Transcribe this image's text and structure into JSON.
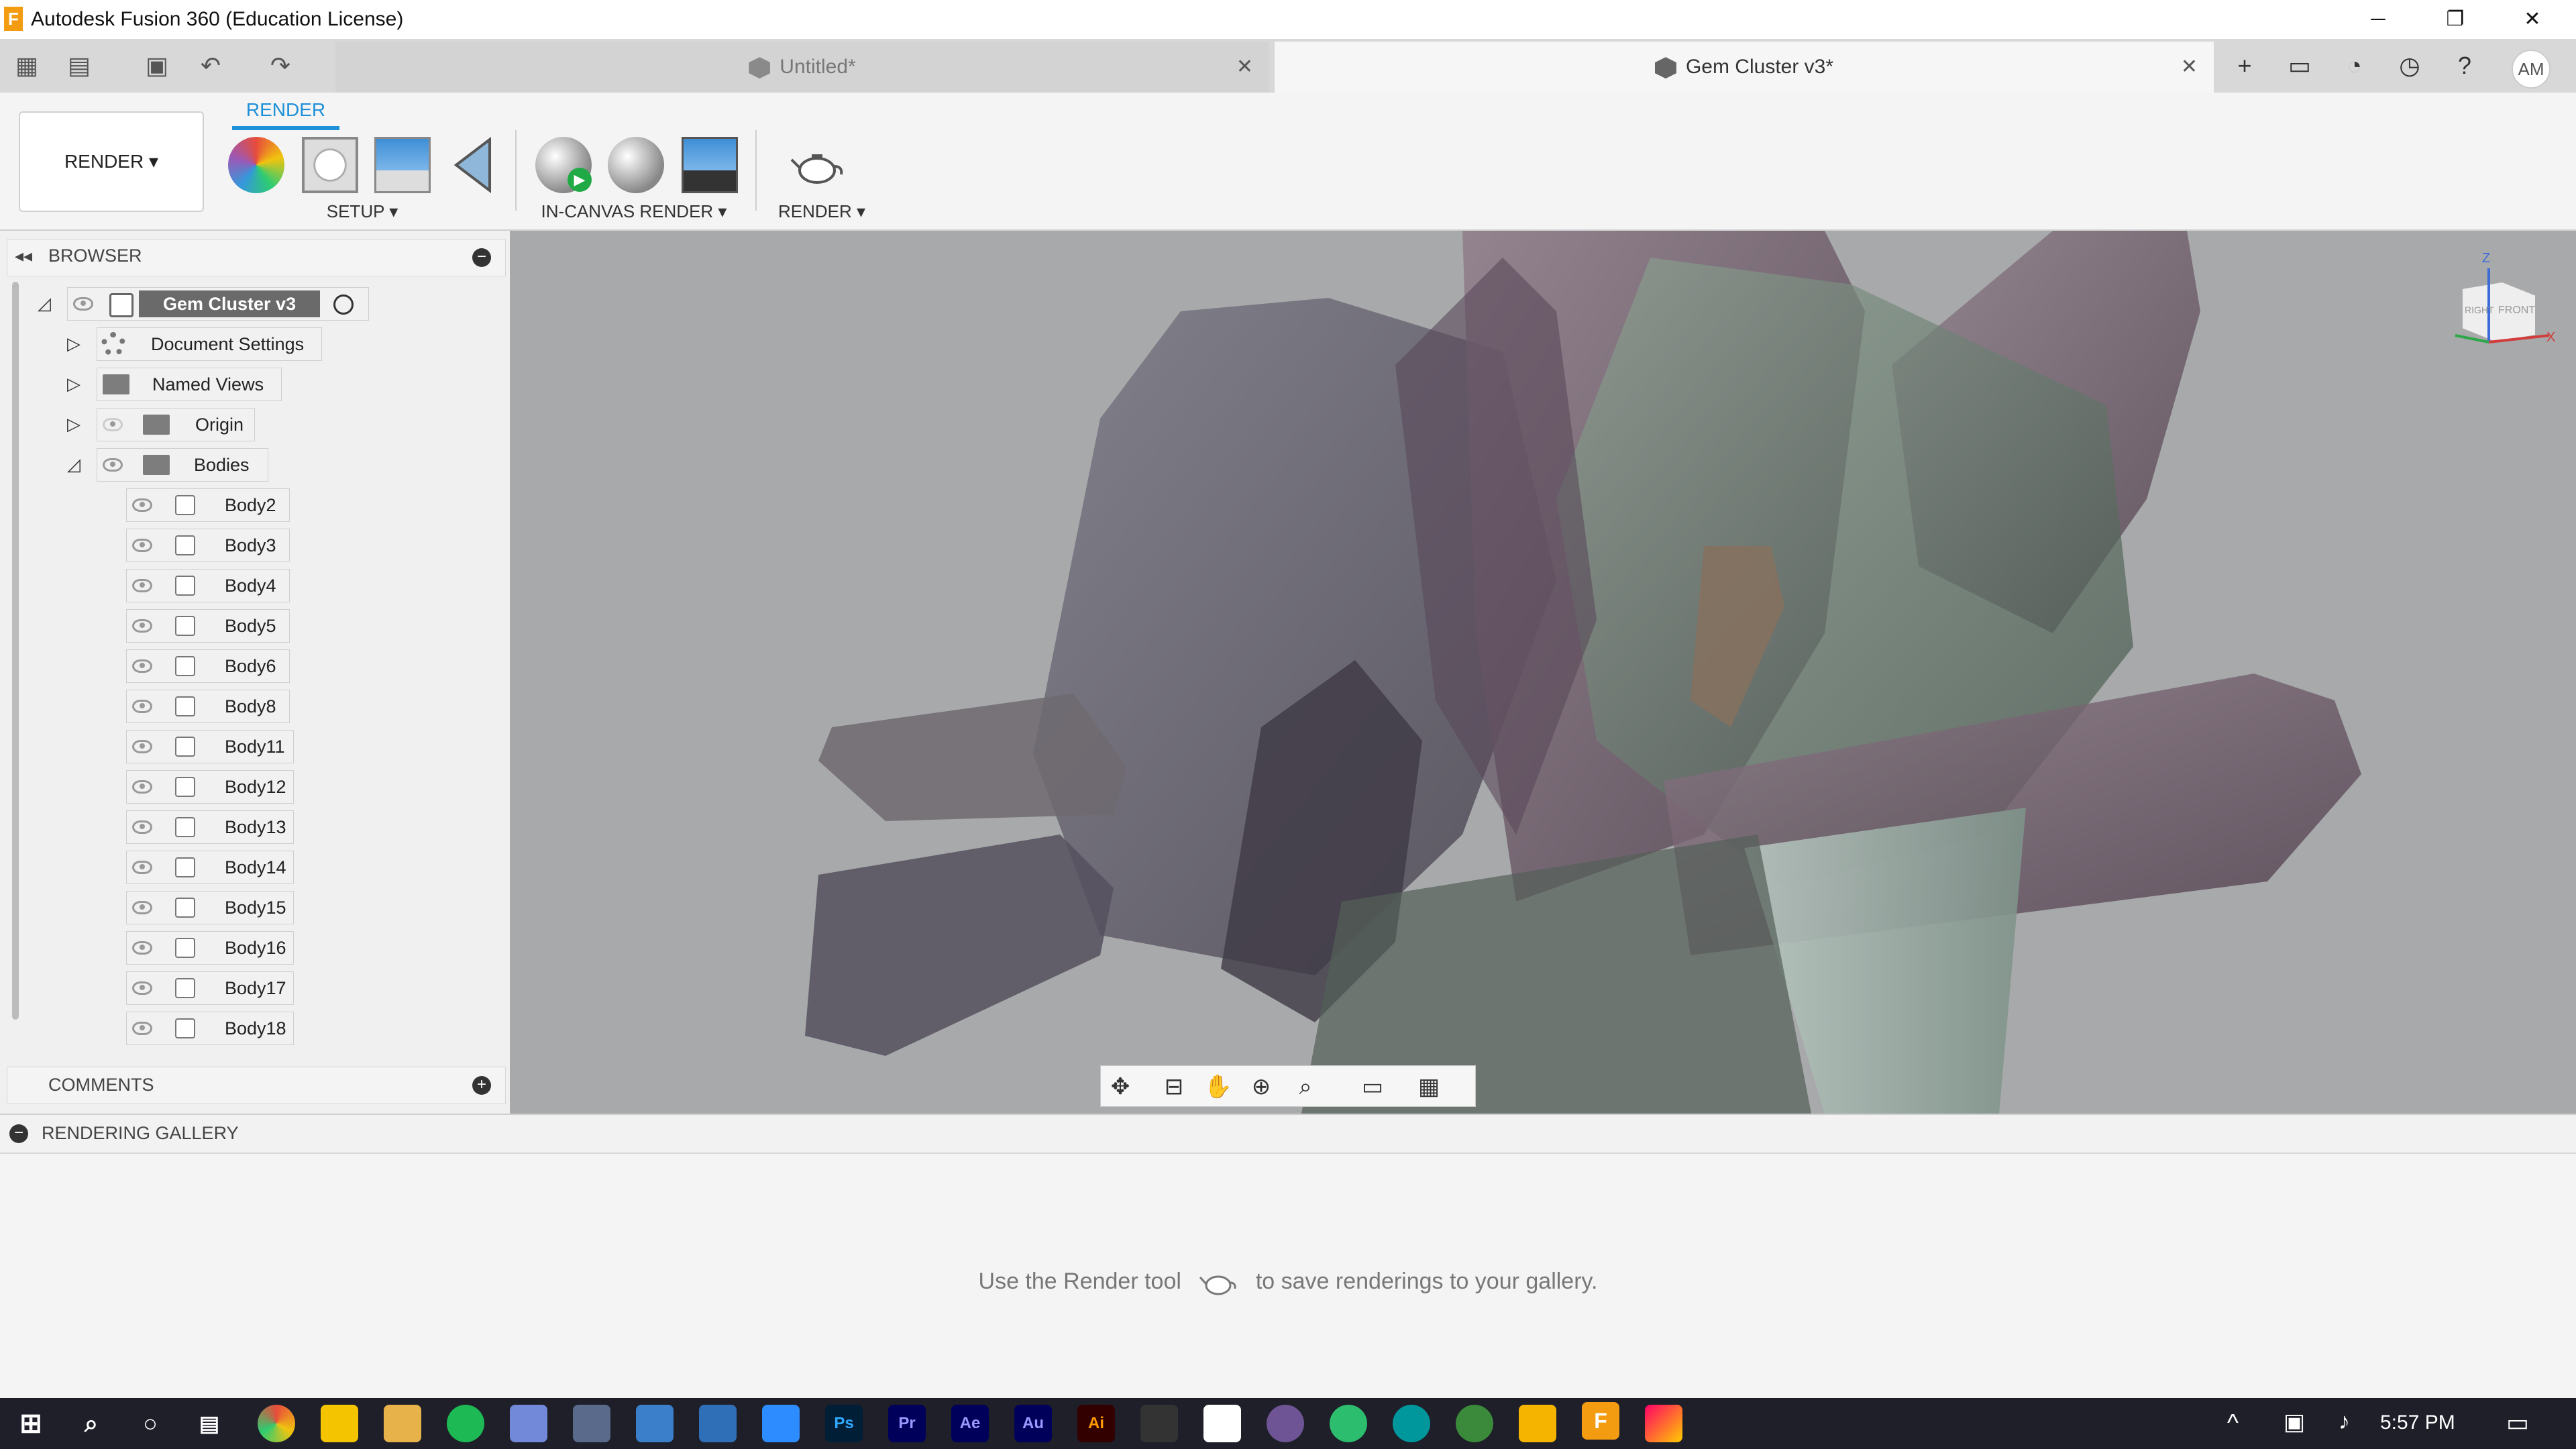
{
  "window": {
    "title": "Autodesk Fusion 360 (Education License)",
    "logo_letter": "F",
    "minimize": "─",
    "restore": "❐",
    "close": "✕"
  },
  "tabs": [
    {
      "label": "Untitled*",
      "close": "✕"
    },
    {
      "label": "Gem Cluster v3*",
      "close": "✕"
    }
  ],
  "toolbar": {
    "workspace": "RENDER ▾",
    "active_tab": "RENDER",
    "groups": {
      "setup": "SETUP ▾",
      "in_canvas": "IN-CANVAS RENDER ▾",
      "render": "RENDER ▾"
    },
    "user_initials": "AM"
  },
  "browser": {
    "title": "BROWSER",
    "root": "Gem Cluster v3",
    "items": [
      {
        "label": "Document Settings"
      },
      {
        "label": "Named Views"
      },
      {
        "label": "Origin"
      },
      {
        "label": "Bodies"
      }
    ],
    "bodies": [
      "Body2",
      "Body3",
      "Body4",
      "Body5",
      "Body6",
      "Body8",
      "Body11",
      "Body12",
      "Body13",
      "Body14",
      "Body15",
      "Body16",
      "Body17",
      "Body18"
    ]
  },
  "comments": {
    "title": "COMMENTS"
  },
  "viewcube": {
    "z": "Z",
    "x": "X",
    "front": "FRONT",
    "right": "RIGHT"
  },
  "gallery": {
    "title": "RENDERING GALLERY",
    "message_before": "Use the Render tool",
    "message_after": "to save renderings to your gallery."
  },
  "taskbar": {
    "time": "5:57 PM",
    "apps": [
      "Ps",
      "Pr",
      "Ae",
      "Au",
      "Ai"
    ]
  },
  "colors": {
    "accent": "#1e90d8",
    "viewport_bg": "#a7a9aa",
    "taskbar_bg": "#1e1f29"
  }
}
